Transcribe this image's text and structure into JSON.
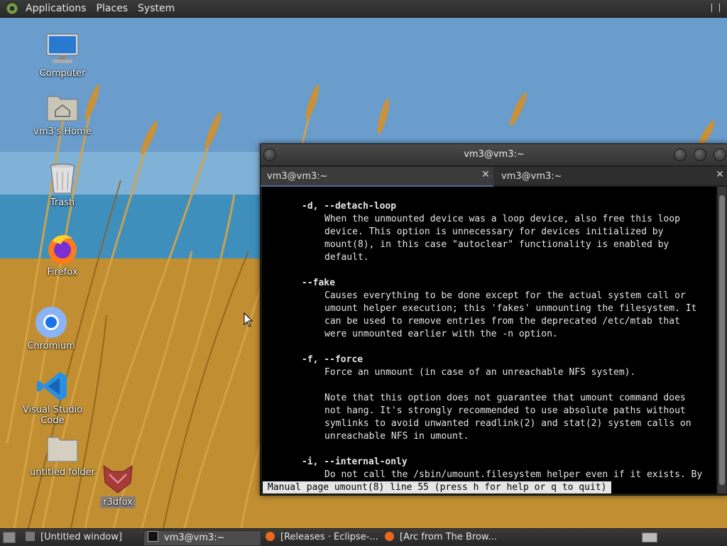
{
  "top_panel": {
    "menus": [
      "Applications",
      "Places",
      "System"
    ]
  },
  "desktop": {
    "icons": [
      {
        "label": "Computer",
        "icon": "computer-icon"
      },
      {
        "label": "vm3's Home",
        "icon": "home-folder-icon"
      },
      {
        "label": "Trash",
        "icon": "trash-icon"
      },
      {
        "label": "Firefox",
        "icon": "firefox-icon"
      },
      {
        "label": "Chromium",
        "icon": "chromium-icon"
      },
      {
        "label": "Visual Studio Code",
        "icon": "vscode-icon"
      },
      {
        "label": "untitled folder",
        "icon": "folder-icon"
      },
      {
        "label": "r3dfox",
        "icon": "r3dfox-icon"
      }
    ]
  },
  "terminal": {
    "title": "vm3@vm3:~",
    "tabs": [
      {
        "label": "vm3@vm3:~",
        "close": "✕"
      },
      {
        "label": "vm3@vm3:~",
        "close": "✕"
      }
    ],
    "lines": [
      "-d, --detach-loop",
      "When the unmounted device was a loop device, also free this loop",
      "device. This option is unnecessary for devices initialized by",
      "mount(8), in this case \"autoclear\" functionality is enabled by",
      "default.",
      "--fake",
      "Causes everything to be done except for the actual system call or",
      "umount helper execution; this 'fakes' unmounting the filesystem. It",
      "can be used to remove entries from the deprecated /etc/mtab that",
      "were unmounted earlier with the -n option.",
      "-f, --force",
      "Force an unmount (in case of an unreachable NFS system).",
      "Note that this option does not guarantee that umount command does",
      "not hang. It's strongly recommended to use absolute paths without",
      "symlinks to avoid unwanted readlink(2) and stat(2) system calls on",
      "unreachable NFS in umount.",
      "-i, --internal-only",
      "Do not call the /sbin/umount.filesystem helper even if it exists. By"
    ],
    "status": "Manual page umount(8) line 55 (press h for help or q to quit)"
  },
  "taskbar": {
    "tasks": [
      {
        "label": "[Untitled window]"
      },
      {
        "label": "vm3@vm3:~"
      },
      {
        "label": "[Releases · Eclipse-..."
      },
      {
        "label": "[Arc from The Brow..."
      }
    ]
  },
  "colors": {
    "panel": "#2e2e2e",
    "terminal_bg": "#000000",
    "terminal_fg": "#e6e6e6",
    "status_bg": "#e6e6e6"
  }
}
